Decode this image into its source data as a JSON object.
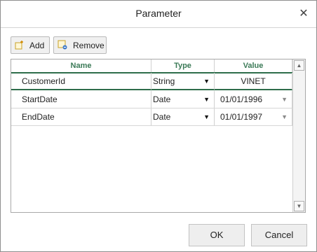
{
  "dialog": {
    "title": "Parameter",
    "close_glyph": "✕"
  },
  "toolbar": {
    "add_label": "Add",
    "remove_label": "Remove"
  },
  "grid": {
    "columns": [
      "Name",
      "Type",
      "Value"
    ],
    "rows": [
      {
        "name": "CustomerId",
        "type": "String",
        "value": "VINET"
      },
      {
        "name": "StartDate",
        "type": "Date",
        "value": "01/01/1996"
      },
      {
        "name": "EndDate",
        "type": "Date",
        "value": "01/01/1997"
      }
    ],
    "dropdown_glyph": "▼",
    "scroll_up_glyph": "▲",
    "scroll_down_glyph": "▼"
  },
  "footer": {
    "ok_label": "OK",
    "cancel_label": "Cancel"
  },
  "colors": {
    "header_text": "#3b7a57",
    "header_rule": "#2e6d4a"
  },
  "icons": {
    "add": "add-parameter-icon",
    "remove": "remove-parameter-icon"
  }
}
